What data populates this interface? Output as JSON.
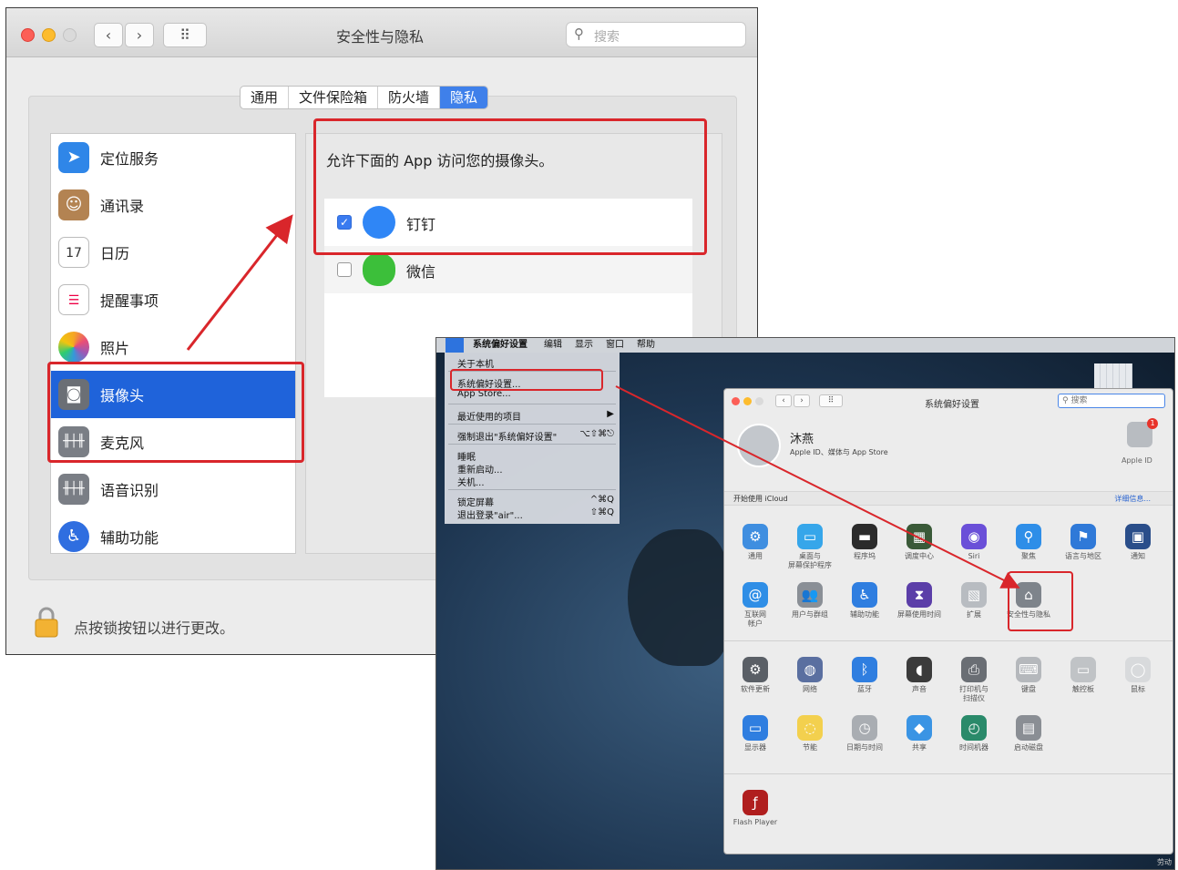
{
  "win1": {
    "title": "安全性与隐私",
    "search_placeholder": "搜索",
    "tabs": [
      {
        "label": "通用",
        "active": false
      },
      {
        "label": "文件保险箱",
        "active": false
      },
      {
        "label": "防火墙",
        "active": false
      },
      {
        "label": "隐私",
        "active": true
      }
    ],
    "sidebar": [
      {
        "label": "定位服务",
        "icon": "location-arrow-icon"
      },
      {
        "label": "通讯录",
        "icon": "contacts-book-icon"
      },
      {
        "label": "日历",
        "icon": "calendar-icon",
        "icon_text": "17"
      },
      {
        "label": "提醒事项",
        "icon": "reminders-icon"
      },
      {
        "label": "照片",
        "icon": "photos-flower-icon"
      },
      {
        "label": "摄像头",
        "icon": "camera-icon",
        "selected": true
      },
      {
        "label": "麦克风",
        "icon": "microphone-waveform-icon"
      },
      {
        "label": "语音识别",
        "icon": "speech-waveform-icon"
      },
      {
        "label": "辅助功能",
        "icon": "accessibility-icon"
      }
    ],
    "right_title": "允许下面的 App 访问您的摄像头。",
    "apps": [
      {
        "name": "钉钉",
        "checked": true
      },
      {
        "name": "微信",
        "checked": false
      }
    ],
    "lock_text": "点按锁按钮以进行更改。"
  },
  "win2": {
    "menubar": [
      "系统偏好设置",
      "编辑",
      "显示",
      "窗口",
      "帮助"
    ],
    "dropdown": [
      {
        "label": "关于本机"
      },
      {
        "label": "系统偏好设置..."
      },
      {
        "label": "App Store..."
      },
      {
        "label": "最近使用的项目",
        "shortcut": "▶"
      },
      {
        "label": "强制退出\"系统偏好设置\"",
        "shortcut": "⌥⇧⌘⎋"
      },
      {
        "label": "睡眠"
      },
      {
        "label": "重新启动..."
      },
      {
        "label": "关机..."
      },
      {
        "label": "锁定屏幕",
        "shortcut": "^⌘Q"
      },
      {
        "label": "退出登录\"air\"...",
        "shortcut": "⇧⌘Q"
      }
    ],
    "prefs": {
      "title": "系统偏好设置",
      "search_placeholder": "搜索",
      "user_name": "沐燕",
      "user_sub": "Apple ID、媒体与 App Store",
      "apple_id_label": "Apple ID",
      "apple_id_badge": "1",
      "icloud_label": "开始使用 iCloud",
      "icloud_more": "详细信息...",
      "row1": [
        {
          "label": "通用",
          "icon": "general-icon",
          "color": "#3f8ee0"
        },
        {
          "label": "桌面与\n屏幕保护程序",
          "icon": "desktop-icon",
          "color": "#36a6ea"
        },
        {
          "label": "程序坞",
          "icon": "dock-icon",
          "color": "#2b2b2b"
        },
        {
          "label": "调度中心",
          "icon": "mission-control-icon",
          "color": "#3a5a38"
        },
        {
          "label": "Siri",
          "icon": "siri-icon",
          "color": "#6a4fd8"
        },
        {
          "label": "聚焦",
          "icon": "spotlight-icon",
          "color": "#2e8ee8"
        },
        {
          "label": "语言与地区",
          "icon": "language-flag-icon",
          "color": "#2f79d8"
        },
        {
          "label": "通知",
          "icon": "notifications-icon",
          "color": "#2a4e8a"
        }
      ],
      "row2": [
        {
          "label": "互联网\n帐户",
          "icon": "internet-accounts-icon",
          "color": "#2f8ee6"
        },
        {
          "label": "用户与群组",
          "icon": "users-groups-icon",
          "color": "#8a8f96"
        },
        {
          "label": "辅助功能",
          "icon": "accessibility-icon",
          "color": "#2f7ee0"
        },
        {
          "label": "屏幕使用时间",
          "icon": "screen-time-icon",
          "color": "#5b3ea8"
        },
        {
          "label": "扩展",
          "icon": "extensions-icon",
          "color": "#b8bcc1"
        },
        {
          "label": "安全性与隐私",
          "icon": "security-house-icon",
          "color": "#7e848b"
        }
      ],
      "row3": [
        {
          "label": "软件更新",
          "icon": "software-update-gear-icon",
          "color": "#5a5f66"
        },
        {
          "label": "网络",
          "icon": "network-globe-icon",
          "color": "#5a6fa0"
        },
        {
          "label": "蓝牙",
          "icon": "bluetooth-icon",
          "color": "#2f7ee0"
        },
        {
          "label": "声音",
          "icon": "speaker-icon",
          "color": "#3b3b3b"
        },
        {
          "label": "打印机与\n扫描仪",
          "icon": "printer-icon",
          "color": "#6a6e74"
        },
        {
          "label": "键盘",
          "icon": "keyboard-icon",
          "color": "#b5b8bc"
        },
        {
          "label": "触控板",
          "icon": "trackpad-icon",
          "color": "#c0c3c6"
        },
        {
          "label": "鼠标",
          "icon": "mouse-icon",
          "color": "#d8dadc"
        }
      ],
      "row4": [
        {
          "label": "显示器",
          "icon": "display-icon",
          "color": "#2f7ee0"
        },
        {
          "label": "节能",
          "icon": "energy-bulb-icon",
          "color": "#f3d04e"
        },
        {
          "label": "日期与时间",
          "icon": "date-time-clock-icon",
          "color": "#a9adb2"
        },
        {
          "label": "共享",
          "icon": "sharing-folder-icon",
          "color": "#3a94e4"
        },
        {
          "label": "时间机器",
          "icon": "time-machine-icon",
          "color": "#2a8a6a"
        },
        {
          "label": "启动磁盘",
          "icon": "startup-disk-icon",
          "color": "#8a8e94"
        }
      ],
      "row5": [
        {
          "label": "Flash Player",
          "icon": "flash-player-icon",
          "color": "#b01e1e"
        }
      ]
    },
    "corner_text": "劳动"
  },
  "colors": {
    "annotation_red": "#d9262b",
    "accent_blue": "#1f63da"
  }
}
